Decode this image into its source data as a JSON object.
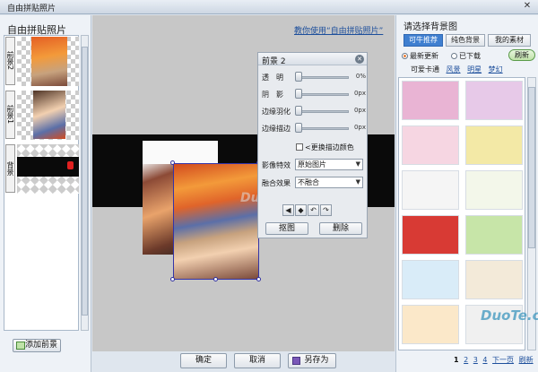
{
  "window": {
    "title": "自由拼贴照片",
    "close_symbol": "✕"
  },
  "left_panel": {
    "heading": "自由拼贴照片",
    "layers": [
      {
        "tag": "前景2"
      },
      {
        "tag": "前景1"
      },
      {
        "tag": "背景"
      }
    ],
    "add_button": "添加前景"
  },
  "stage": {
    "help_link": "教你使用“自由拼贴照片”",
    "watermark": "DuoTe.com"
  },
  "panel": {
    "title": "前景 2",
    "sliders": [
      {
        "label": "透　明",
        "value": "0%"
      },
      {
        "label": "阴　影",
        "value": "0px"
      },
      {
        "label": "边缘羽化",
        "value": "0px"
      },
      {
        "label": "边缘描边",
        "value": "0px"
      }
    ],
    "border_color_label": "<更换描边颜色",
    "effect_label": "影像特效",
    "effect_value": "原始图片",
    "blend_label": "融合效果",
    "blend_value": "不融合",
    "icons": [
      "◀",
      "◆",
      "↶",
      "↷"
    ],
    "crop_button": "抠图",
    "delete_button": "删除"
  },
  "bottom": {
    "ok": "确定",
    "cancel": "取消",
    "save_as": "另存为"
  },
  "right_panel": {
    "heading": "请选择背景图",
    "tabs": [
      "可牛推荐",
      "纯色背景",
      "我的素材"
    ],
    "radios": [
      "最新更新",
      "已下载"
    ],
    "refresh": "刷新",
    "categories": [
      "可爱卡通",
      "风景",
      "明星",
      "梦幻"
    ],
    "pager": {
      "pages": [
        "1",
        "2",
        "3",
        "4"
      ],
      "next": "下一页",
      "refresh": "刷新"
    },
    "watermark": "DuoTe.com",
    "tile_colors": [
      "#e9b4d4",
      "#e7c9e8",
      "#f6d6e2",
      "#f3e9a6",
      "#f5f5f5",
      "#f3f7ea",
      "#d83a34",
      "#c7e5a8",
      "#d9ecf8",
      "#f3ead9",
      "#fbe8c9",
      "#f0f0f0"
    ]
  },
  "colors": {
    "accent": "#3f7fd0",
    "link": "#1d4f9c",
    "selection": "#3434a8"
  }
}
